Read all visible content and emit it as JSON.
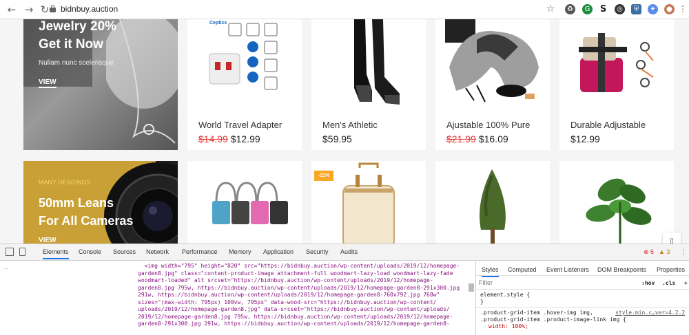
{
  "browser": {
    "url": "bidnbuy.auction"
  },
  "banners": [
    {
      "lines": [
        "Jewelry 20%",
        "Get it Now"
      ],
      "sub": "Nullam nunc scelerisque",
      "cta": "VIEW"
    },
    {
      "tag": "MANY HEADINGS",
      "lines": [
        "50mm Leans",
        "For All Cameras"
      ],
      "cta": "VIEW"
    }
  ],
  "products": [
    {
      "name": "World Travel Adapter",
      "old_price": "$14.99",
      "price": "$12.99"
    },
    {
      "name": "Men's Athletic",
      "old_price": "",
      "price": "$59.95"
    },
    {
      "name": "Ajustable 100% Pure",
      "old_price": "$21.99",
      "price": "$16.09"
    },
    {
      "name": "Durable Adjustable",
      "old_price": "",
      "price": "$12.99"
    }
  ],
  "sale_badge": "-21%",
  "adapter_brand": "Ceptics",
  "devtools": {
    "tabs": [
      "Elements",
      "Console",
      "Sources",
      "Network",
      "Performance",
      "Memory",
      "Application",
      "Security",
      "Audits"
    ],
    "errors": "6",
    "warnings": "3",
    "styles_tabs": [
      "Styles",
      "Computed",
      "Event Listeners",
      "DOM Breakpoints",
      "Properties"
    ],
    "filter_placeholder": "Filter",
    "hov": ":hov",
    "cls": ".cls",
    "element_style": "element.style {",
    "brace": "}",
    "rule_sel1": ".product-grid-item .hover-img img,",
    "rule_sel2": ".product-grid-item .product-image-link img {",
    "rule_src": "style.min.c…ver=4.2.2",
    "rule_prop": "width: 100%;",
    "ellipsis": "...",
    "code_lines": [
      "  <img width=\"795\" height=\"820\" src=\"https://bidnbuy.auction/wp-content/uploads/2019/12/homepage-",
      "garden8.jpg\" class=\"content-product-image attachment-full woodmart-lazy-load woodmart-lazy-fade",
      "woodmart-loaded\" alt srcset=\"https://bidnbuy.auction/wp-content/uploads/2019/12/homepage-",
      "garden8.jpg 795w, https://bidnbuy.auction/wp-content/uploads/2019/12/homepage-garden8-291x300.jpg",
      "291w, https://bidnbuy.auction/wp-content/uploads/2019/12/homepage-garden8-768x792.jpg 768w\"",
      "sizes=\"(max-width: 795px) 100vw, 795px\" data-wood-src=\"https://bidnbuy.auction/wp-content/",
      "uploads/2019/12/homepage-garden8.jpg\" data-srcset=\"https://bidnbuy.auction/wp-content/uploads/",
      "2019/12/homepage-garden8.jpg 795w, https://bidnbuy.auction/wp-content/uploads/2019/12/homepage-",
      "garden8-291x300.jpg 291w, https://bidnbuy.auction/wp-content/uploads/2019/12/homepage-garden8-"
    ]
  },
  "colors": {
    "accent": "#f9a825",
    "sale": "#e53935",
    "devtools_tab": "#1a73e8"
  }
}
